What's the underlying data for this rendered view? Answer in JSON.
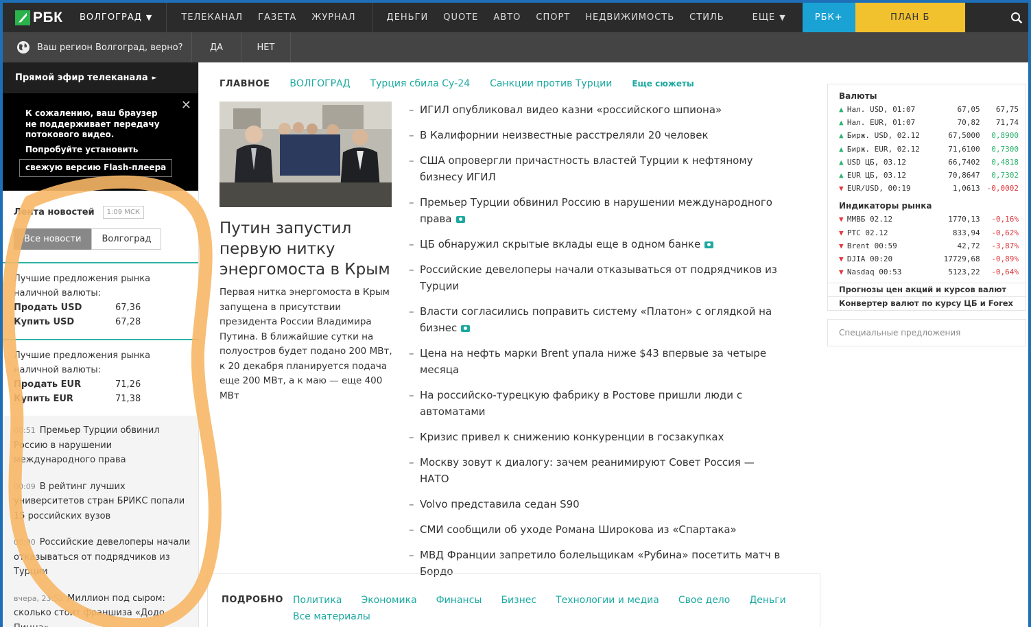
{
  "header": {
    "logo": "РБК",
    "region": "ВОЛГОГРАД",
    "media": [
      "ТЕЛЕКАНАЛ",
      "ГАЗЕТА",
      "ЖУРНАЛ"
    ],
    "sections": [
      "ДЕНЬГИ",
      "QUOTE",
      "АВТО",
      "СПОРТ",
      "НЕДВИЖИМОСТЬ",
      "СТИЛЬ"
    ],
    "more": "ЕЩЕ",
    "rbk_plus": "РБК+",
    "plan_b": "ПЛАН Б"
  },
  "region_bar": {
    "question": "Ваш регион Волгоград, верно?",
    "yes": "ДА",
    "no": "НЕТ"
  },
  "sidebar": {
    "live_title": "Прямой эфир телеканала",
    "flash_msg": [
      "К сожалению, ваш браузер",
      "не поддерживает передачу",
      "потокового видео."
    ],
    "flash_install": "Попробуйте установить",
    "flash_btn": "свежую версию Flash-плеера",
    "feed_title": "Лента новостей",
    "feed_time": "1:09 МСК",
    "tabs": [
      "Все новости",
      "Волгоград"
    ],
    "offers": [
      {
        "title": "Лучшие предложения рынка наличной валюты:",
        "sell_label": "Продать USD",
        "sell": "67,36",
        "buy_label": "Купить USD",
        "buy": "67,28"
      },
      {
        "title": "Лучшие предложения рынка наличной валюты:",
        "sell_label": "Продать EUR",
        "sell": "71,26",
        "buy_label": "Купить EUR",
        "buy": "71,38"
      }
    ],
    "news": [
      {
        "time": "00:51",
        "text": "Премьер Турции обвинил Россию в нарушении международного права"
      },
      {
        "time": "00:09",
        "text": "В рейтинг лучших университетов стран БРИКС попали 15 российских вузов"
      },
      {
        "time": "00:00",
        "text": "Российские девелоперы начали отказываться от подрядчиков из Турции"
      },
      {
        "time": "вчера, 23:52",
        "text": "Миллион под сыром: сколько стоит франшиза «Додо Пицца»"
      }
    ]
  },
  "main": {
    "categories": {
      "main": "ГЛАВНОЕ",
      "links": [
        "ВОЛГОГРАД",
        "Турция сбила Су-24",
        "Санкции против Турции"
      ],
      "more": "Еще сюжеты"
    },
    "lead": {
      "title": "Путин запустил первую нитку энергомоста в Крым",
      "text": "Первая нитка энергомоста в Крым запущена в присутствии президента России Владимира Путина. В ближайшие сутки на полуостров будет подано 200 МВт, к 20 декабря планируется подача еще 200 МВт, а к маю — еще 400 МВт"
    },
    "headlines": [
      {
        "text": "ИГИЛ опубликовал видео казни «российского шпиона»",
        "photo": false
      },
      {
        "text": "В Калифорнии неизвестные расстреляли 20 человек",
        "photo": false
      },
      {
        "text": "США опровергли причастность властей Турции к нефтяному бизнесу ИГИЛ",
        "photo": false
      },
      {
        "text": "Премьер Турции обвинил Россию в нарушении международного права",
        "photo": true
      },
      {
        "text": "ЦБ обнаружил скрытые вклады еще в одном банке",
        "photo": true
      },
      {
        "text": "Российские девелоперы начали отказываться от подрядчиков из Турции",
        "photo": false
      },
      {
        "text": "Власти согласились поправить систему «Платон» с оглядкой на бизнес",
        "photo": true
      },
      {
        "text": "Цена на нефть марки Brent упала ниже $43 впервые за четыре месяца",
        "photo": false
      },
      {
        "text": "На российско-турецкую фабрику в Ростове пришли люди с автоматами",
        "photo": false
      },
      {
        "text": "Кризис привел к снижению конкуренции в госзакупках",
        "photo": false
      },
      {
        "text": "Москву зовут к диалогу: зачем реанимируют Совет Россия — НАТО",
        "photo": false
      },
      {
        "text": "Volvo представила седан S90",
        "photo": false
      },
      {
        "text": "СМИ сообщили об уходе Романа Широкова из «Спартака»",
        "photo": false
      },
      {
        "text": "МВД Франции запретило болельщикам «Рубина» посетить матч в Бордо",
        "photo": false
      }
    ],
    "more_section": {
      "label": "ПОДРОБНО",
      "links": [
        "Политика",
        "Экономика",
        "Финансы",
        "Бизнес",
        "Технологии и медиа",
        "Свое дело",
        "Деньги",
        "Все материалы"
      ]
    }
  },
  "rates": {
    "currencies_title": "Валюты",
    "currencies": [
      {
        "dir": "up",
        "name": "Нал. USD, 01:07",
        "v1": "67,05",
        "v2": "67,75",
        "v2_style": "plain"
      },
      {
        "dir": "up",
        "name": "Нал. EUR, 01:07",
        "v1": "70,82",
        "v2": "71,74",
        "v2_style": "plain"
      },
      {
        "dir": "up",
        "name": "Бирж. USD, 02.12",
        "v1": "67,5000",
        "v2": "0,8900",
        "v2_style": "up"
      },
      {
        "dir": "up",
        "name": "Бирж. EUR, 02.12",
        "v1": "71,6100",
        "v2": "0,7300",
        "v2_style": "up"
      },
      {
        "dir": "up",
        "name": "USD ЦБ, 03.12",
        "v1": "66,7402",
        "v2": "0,4818",
        "v2_style": "up"
      },
      {
        "dir": "up",
        "name": "EUR ЦБ, 03.12",
        "v1": "70,8647",
        "v2": "0,7302",
        "v2_style": "up"
      },
      {
        "dir": "down",
        "name": "EUR/USD, 00:19",
        "v1": "1,0613",
        "v2": "-0,0002",
        "v2_style": "down"
      }
    ],
    "indicators_title": "Индикаторы рынка",
    "indicators": [
      {
        "dir": "down",
        "name": "ММВБ 02.12",
        "v1": "1770,13",
        "v2": "-0,16%",
        "v2_style": "down"
      },
      {
        "dir": "down",
        "name": "РТС 02.12",
        "v1": "833,94",
        "v2": "-0,62%",
        "v2_style": "down"
      },
      {
        "dir": "down",
        "name": "Brent 00:59",
        "v1": "42,72",
        "v2": "-3,87%",
        "v2_style": "down"
      },
      {
        "dir": "down",
        "name": "DJIA 00:20",
        "v1": "17729,68",
        "v2": "-0,89%",
        "v2_style": "down"
      },
      {
        "dir": "down",
        "name": "Nasdaq 00:53",
        "v1": "5123,22",
        "v2": "-0,64%",
        "v2_style": "down"
      }
    ],
    "links": [
      "Прогнозы цен акций и курсов валют",
      "Конвертер валют по курсу ЦБ и Forex"
    ],
    "special": "Специальные предложения"
  },
  "colors": {
    "accent": "#1ba9a0",
    "plan_b": "#f2c12e",
    "rbk_plus": "#1aa2d4",
    "marker": "#f7b766"
  }
}
